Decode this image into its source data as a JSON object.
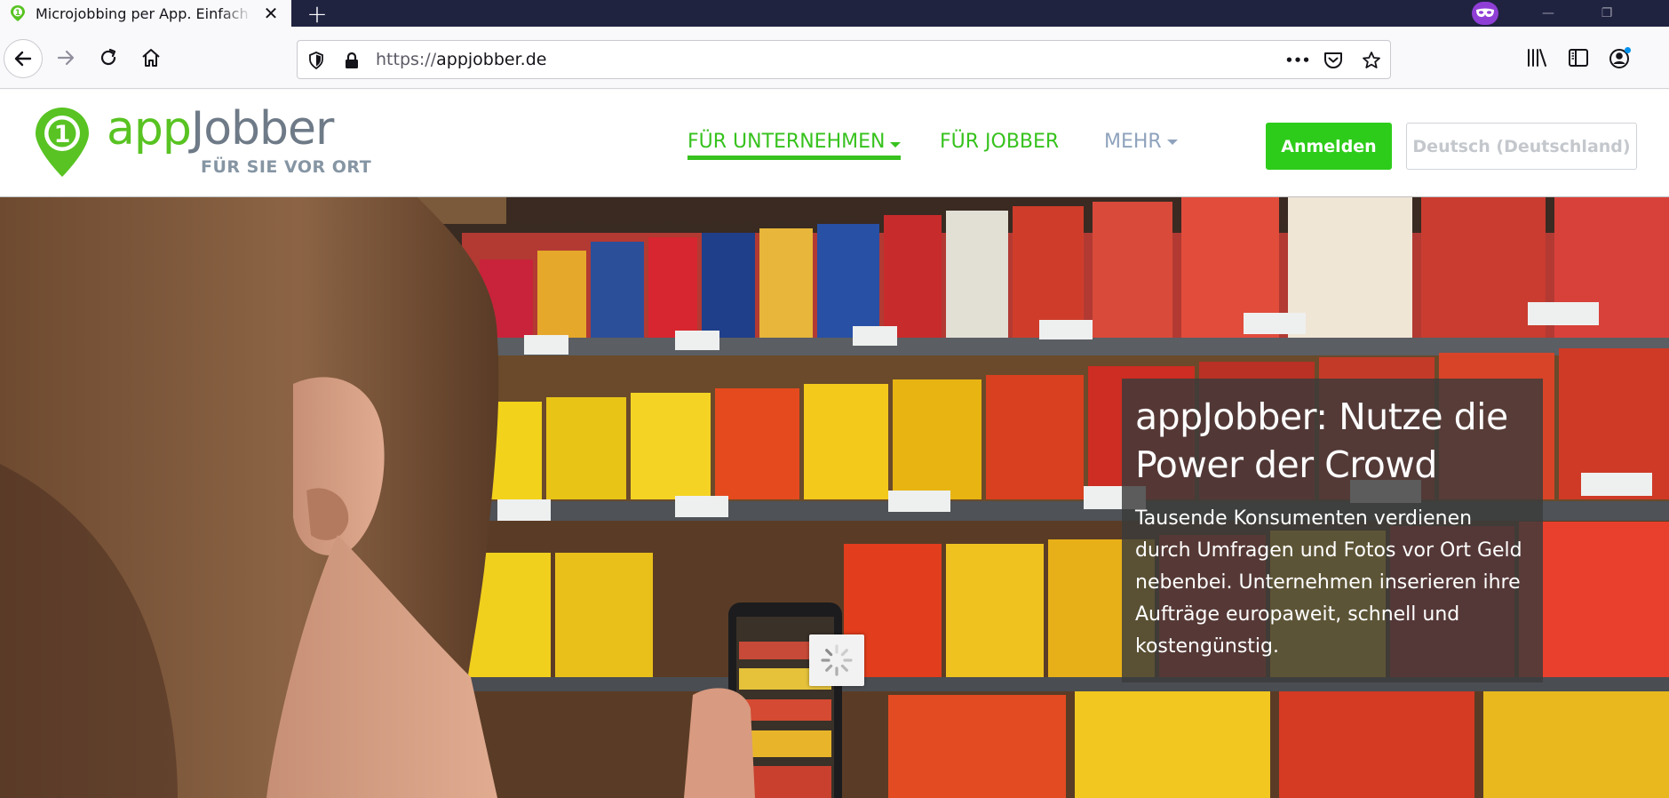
{
  "browser": {
    "tab_title": "Microjobbing per App. Einfach",
    "tab_close": "✕",
    "new_tab": "+",
    "url_scheme": "https://",
    "url_host": "appjobber.de",
    "url_more": "•••",
    "window_minimize": "—",
    "window_restore": "❐",
    "accent_color": "#202340",
    "private_color": "#8f3fd6"
  },
  "site": {
    "logo_app": "app",
    "logo_jobber": "Jobber",
    "logo_tagline": "FÜR SIE VOR ORT",
    "logo_digit": "1",
    "brand_green": "#37c21e",
    "nav": {
      "unternehmen": "FÜR UNTERNEHMEN",
      "jobber": "FÜR JOBBER",
      "mehr": "MEHR"
    },
    "login_label": "Anmelden",
    "language_label": "Deutsch (Deutschland)"
  },
  "hero": {
    "title": "appJobber: Nutze die Power der Crowd",
    "text": "Tausende Konsumenten verdienen durch Umfragen und Fotos vor Ort Geld nebenbei. Unternehmen inserieren ihre Aufträge europaweit, schnell und kostengünstig."
  }
}
